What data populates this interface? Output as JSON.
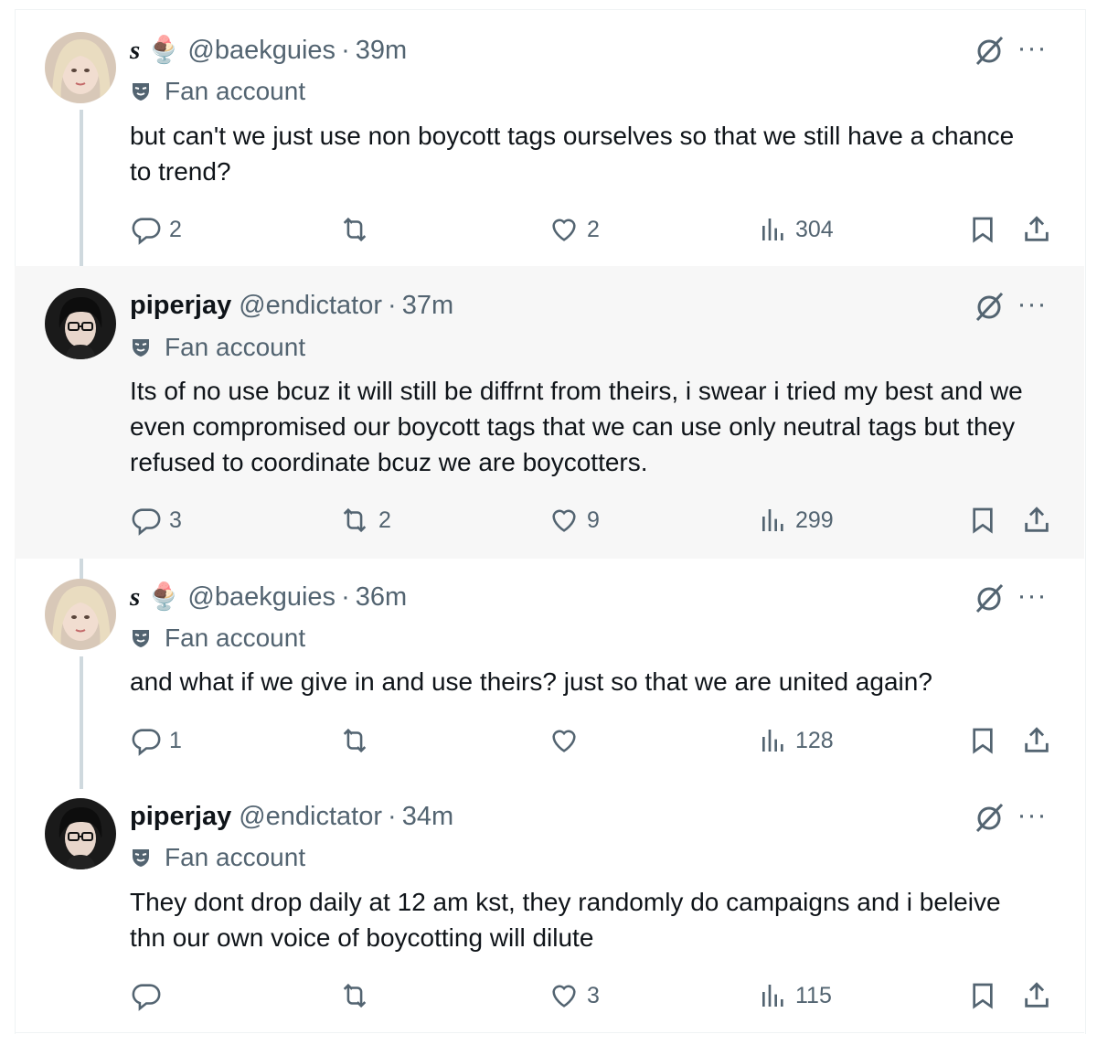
{
  "tweets": [
    {
      "name": "s",
      "name_emoji": "🍨",
      "handle": "@baekguies",
      "separator": "·",
      "time": "39m",
      "label": "Fan account",
      "text": "but can't we just use non boycott tags ourselves so that we still have a chance to trend?",
      "replies": "2",
      "reposts": "",
      "likes": "2",
      "views": "304"
    },
    {
      "name": "piperjay",
      "handle": "@endictator",
      "separator": "·",
      "time": "37m",
      "label": "Fan account",
      "text": "Its of no use bcuz it will still be diffrnt from theirs, i swear i tried my best and we even compromised our boycott tags that we can use only neutral tags but they refused to coordinate bcuz we are boycotters.",
      "replies": "3",
      "reposts": "2",
      "likes": "9",
      "views": "299"
    },
    {
      "name": "s",
      "name_emoji": "🍨",
      "handle": "@baekguies",
      "separator": "·",
      "time": "36m",
      "label": "Fan account",
      "text": "and what if we give in and use theirs? just so that we are united again?",
      "replies": "1",
      "reposts": "",
      "likes": "",
      "views": "128"
    },
    {
      "name": "piperjay",
      "handle": "@endictator",
      "separator": "·",
      "time": "34m",
      "label": "Fan account",
      "text": "They dont drop daily at 12 am kst, they randomly do campaigns and i beleive thn our own voice of boycotting will dilute",
      "replies": "",
      "reposts": "",
      "likes": "3",
      "views": "115"
    }
  ],
  "icons": {
    "reply": "reply-icon",
    "repost": "repost-icon",
    "like": "heart-icon",
    "views": "views-icon",
    "bookmark": "bookmark-icon",
    "share": "share-icon",
    "grok": "grok-icon",
    "more": "more-icon",
    "label": "mask-icon"
  },
  "colors": {
    "text": "#0f1419",
    "secondary": "#536471",
    "highlight_bg": "#f7f7f7",
    "thread_line": "#cfd9de"
  },
  "more_glyph": "···"
}
